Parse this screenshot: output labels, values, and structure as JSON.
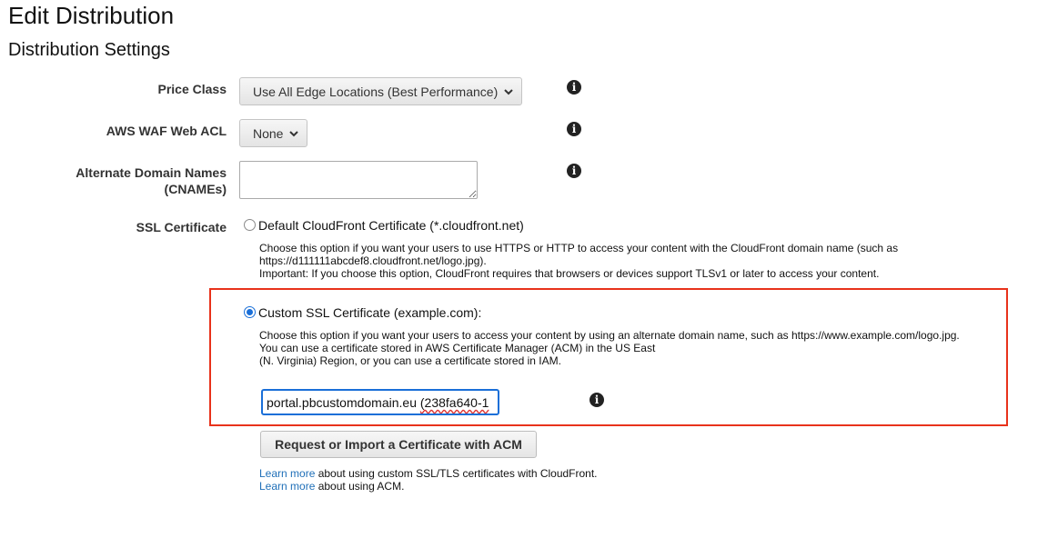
{
  "page": {
    "title": "Edit Distribution",
    "section_title": "Distribution Settings"
  },
  "fields": {
    "price_class": {
      "label": "Price Class",
      "selected": "Use All Edge Locations (Best Performance)"
    },
    "waf": {
      "label": "AWS WAF Web ACL",
      "selected": "None"
    },
    "cnames": {
      "label_line1": "Alternate Domain Names",
      "label_line2": "(CNAMEs)",
      "value": ""
    },
    "ssl": {
      "label": "SSL Certificate",
      "default_option": {
        "label": "Default CloudFront Certificate (*.cloudfront.net)",
        "checked": false,
        "help_line1": "Choose this option if you want your users to use HTTPS or HTTP to access your content with the CloudFront domain name (such as",
        "help_line2": "https://d111111abcdef8.cloudfront.net/logo.jpg).",
        "help_line3": "Important: If you choose this option, CloudFront requires that browsers or devices support TLSv1 or later to access your content."
      },
      "custom_option": {
        "label": "Custom SSL Certificate (example.com):",
        "checked": true,
        "help_line1": "Choose this option if you want your users to access your content by using an alternate domain name, such as https://www.example.com/logo.jpg.",
        "help_line2": "You can use a certificate stored in AWS Certificate Manager (ACM) in the US East",
        "help_line3": "(N. Virginia) Region, or you can use a certificate stored in IAM."
      },
      "certificate_input": {
        "value_domain": "portal.pbcustomdomain.eu",
        "value_id": "(238fa640-1"
      },
      "acm_button_label": "Request or Import a Certificate with ACM",
      "learn_more_1": {
        "link": "Learn more",
        "text": " about using custom SSL/TLS certificates with CloudFront."
      },
      "learn_more_2": {
        "link": "Learn more",
        "text": " about using ACM."
      }
    }
  },
  "icons": {
    "info": "info-icon",
    "chevron": "chevron-down-icon"
  },
  "colors": {
    "highlight": "#e8321b",
    "focus": "#1a6fd8",
    "link": "#1f6fb8"
  }
}
